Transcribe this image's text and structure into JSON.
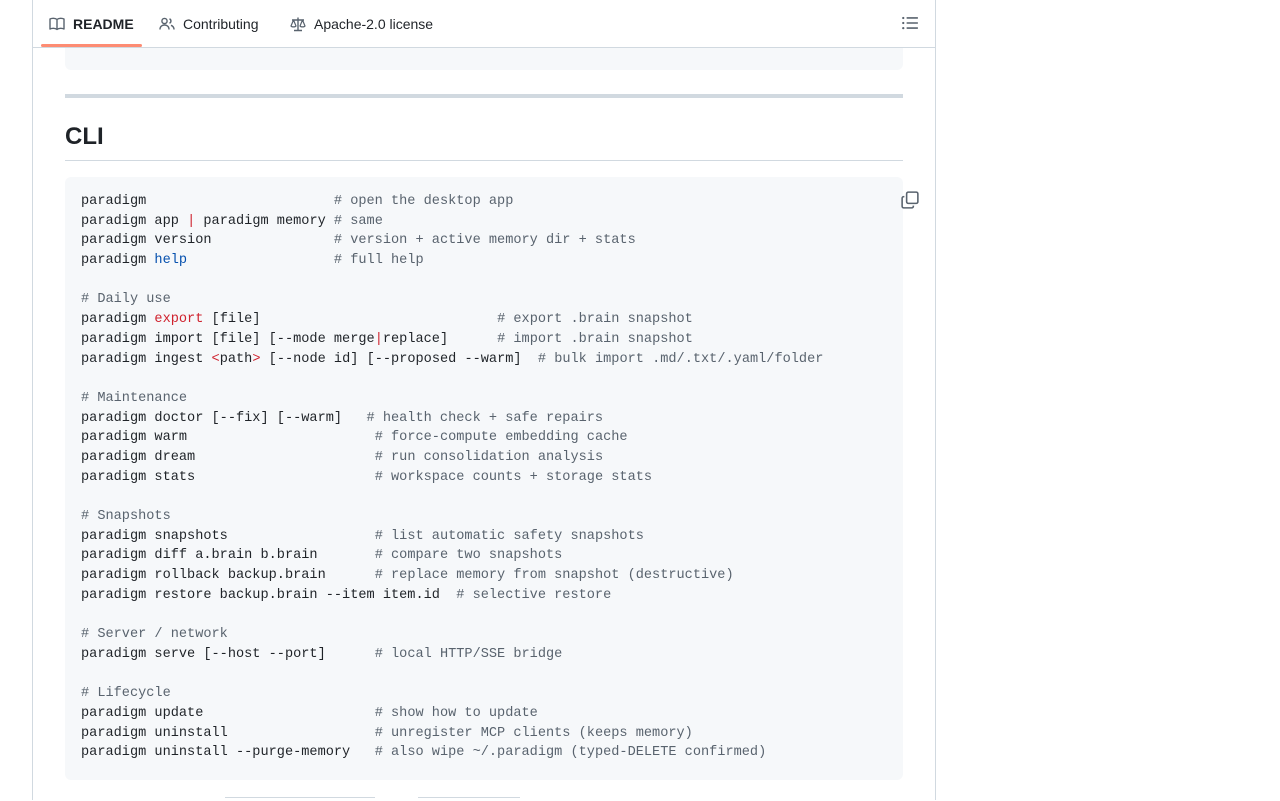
{
  "tabs": [
    {
      "label": "README",
      "icon": "book-icon",
      "active": true
    },
    {
      "label": "Contributing",
      "icon": "people-icon",
      "active": false
    },
    {
      "label": "Apache-2.0 license",
      "icon": "law-icon",
      "active": false
    }
  ],
  "outline_icon": "list-icon",
  "section": {
    "title": "CLI"
  },
  "copy_icon": "copy-icon",
  "colors": {
    "accent_tab": "#fd8c73",
    "comment": "#59636e",
    "keyword_red": "#cf222e",
    "keyword_blue": "#0550ae",
    "code_bg": "#f6f8fa",
    "border": "#d1d9e0"
  },
  "code_lines": [
    [
      [
        "paradigm                       ",
        "n"
      ],
      [
        "# open the desktop app",
        "c"
      ]
    ],
    [
      [
        "paradigm app ",
        "n"
      ],
      [
        "|",
        "red"
      ],
      [
        " paradigm memory ",
        "n"
      ],
      [
        "# same",
        "c"
      ]
    ],
    [
      [
        "paradigm version               ",
        "n"
      ],
      [
        "# version + active memory dir + stats",
        "c"
      ]
    ],
    [
      [
        "paradigm ",
        "n"
      ],
      [
        "help",
        "blue"
      ],
      [
        "                  ",
        "n"
      ],
      [
        "# full help",
        "c"
      ]
    ],
    [],
    [
      [
        "# Daily use",
        "c"
      ]
    ],
    [
      [
        "paradigm ",
        "n"
      ],
      [
        "export",
        "red"
      ],
      [
        " [file]                             ",
        "n"
      ],
      [
        "# export .brain snapshot",
        "c"
      ]
    ],
    [
      [
        "paradigm import [file] [--mode merge",
        "n"
      ],
      [
        "|",
        "red"
      ],
      [
        "replace]      ",
        "n"
      ],
      [
        "# import .brain snapshot",
        "c"
      ]
    ],
    [
      [
        "paradigm ingest ",
        "n"
      ],
      [
        "<",
        "red"
      ],
      [
        "path",
        "n"
      ],
      [
        ">",
        "red"
      ],
      [
        " [--node id] [--proposed --warm]  ",
        "n"
      ],
      [
        "# bulk import .md/.txt/.yaml/folder",
        "c"
      ]
    ],
    [],
    [
      [
        "# Maintenance",
        "c"
      ]
    ],
    [
      [
        "paradigm doctor [--fix] [--warm]   ",
        "n"
      ],
      [
        "# health check + safe repairs",
        "c"
      ]
    ],
    [
      [
        "paradigm warm                       ",
        "n"
      ],
      [
        "# force-compute embedding cache",
        "c"
      ]
    ],
    [
      [
        "paradigm dream                      ",
        "n"
      ],
      [
        "# run consolidation analysis",
        "c"
      ]
    ],
    [
      [
        "paradigm stats                      ",
        "n"
      ],
      [
        "# workspace counts + storage stats",
        "c"
      ]
    ],
    [],
    [
      [
        "# Snapshots",
        "c"
      ]
    ],
    [
      [
        "paradigm snapshots                  ",
        "n"
      ],
      [
        "# list automatic safety snapshots",
        "c"
      ]
    ],
    [
      [
        "paradigm diff a.brain b.brain       ",
        "n"
      ],
      [
        "# compare two snapshots",
        "c"
      ]
    ],
    [
      [
        "paradigm rollback backup.brain      ",
        "n"
      ],
      [
        "# replace memory from snapshot (destructive)",
        "c"
      ]
    ],
    [
      [
        "paradigm restore backup.brain --item item.id  ",
        "n"
      ],
      [
        "# selective restore",
        "c"
      ]
    ],
    [],
    [
      [
        "# Server / network",
        "c"
      ]
    ],
    [
      [
        "paradigm serve [--host --port]      ",
        "n"
      ],
      [
        "# local HTTP/SSE bridge",
        "c"
      ]
    ],
    [],
    [
      [
        "# Lifecycle",
        "c"
      ]
    ],
    [
      [
        "paradigm update                     ",
        "n"
      ],
      [
        "# show how to update",
        "c"
      ]
    ],
    [
      [
        "paradigm uninstall                  ",
        "n"
      ],
      [
        "# unregister MCP clients (keeps memory)",
        "c"
      ]
    ],
    [
      [
        "paradigm uninstall --purge-memory   ",
        "n"
      ],
      [
        "# also wipe ~/.paradigm (typed-DELETE confirmed)",
        "c"
      ]
    ]
  ]
}
